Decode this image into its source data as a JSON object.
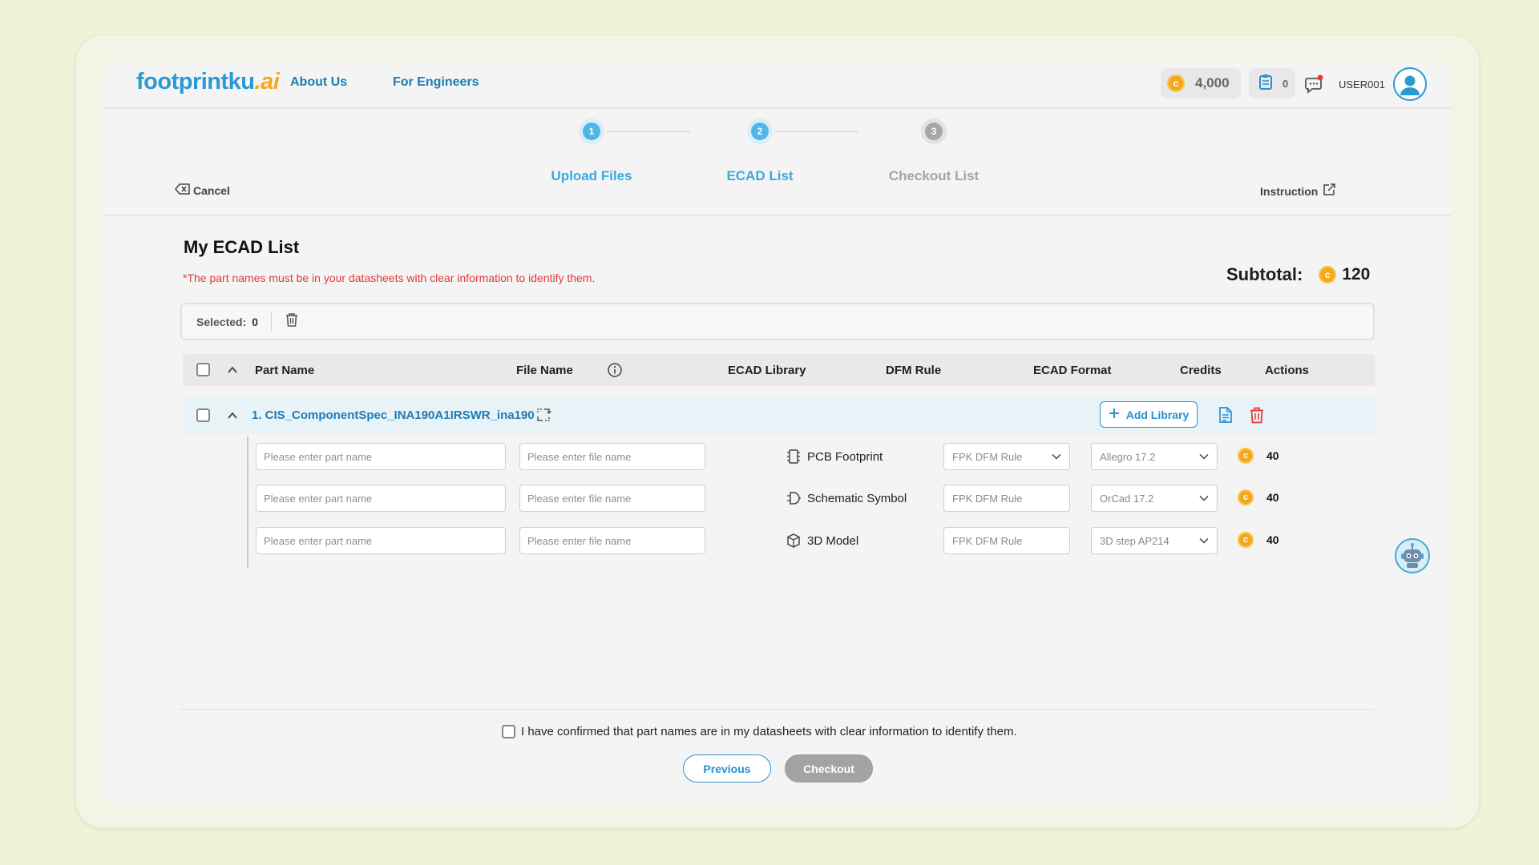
{
  "header": {
    "logo_main": "footprintku",
    "logo_suffix": ".ai",
    "nav": [
      "About Us",
      "For Engineers"
    ],
    "credits": "4,000",
    "cart_count": "0",
    "username": "USER001"
  },
  "stepper": {
    "cancel_label": "Cancel",
    "steps": [
      {
        "num": "1",
        "label": "Upload Files",
        "state": "active"
      },
      {
        "num": "2",
        "label": "ECAD List",
        "state": "active"
      },
      {
        "num": "3",
        "label": "Checkout List",
        "state": "inactive"
      }
    ],
    "instruction_label": "Instruction"
  },
  "list": {
    "title": "My ECAD List",
    "warning": "*The part names must be in your datasheets with clear information to identify them.",
    "subtotal_label": "Subtotal:",
    "subtotal_value": "120",
    "selected_label": "Selected:",
    "selected_count": "0"
  },
  "table": {
    "headers": {
      "part_name": "Part Name",
      "file_name": "File Name",
      "ecad_library": "ECAD Library",
      "dfm_rule": "DFM Rule",
      "ecad_format": "ECAD Format",
      "credits": "Credits",
      "actions": "Actions"
    },
    "group": {
      "name": "1. CIS_ComponentSpec_INA190A1IRSWR_ina190",
      "add_library_label": "Add Library"
    },
    "rows": [
      {
        "part_placeholder": "Please enter part name",
        "file_placeholder": "Please enter file name",
        "library": "PCB Footprint",
        "dfm_rule": "FPK DFM Rule",
        "format": "Allegro 17.2",
        "credits": "40"
      },
      {
        "part_placeholder": "Please enter part name",
        "file_placeholder": "Please enter file name",
        "library": "Schematic Symbol",
        "dfm_rule": "FPK DFM Rule",
        "format": "OrCad 17.2",
        "credits": "40"
      },
      {
        "part_placeholder": "Please enter part name",
        "file_placeholder": "Please enter file name",
        "library": "3D Model",
        "dfm_rule": "FPK DFM Rule",
        "format": "3D step AP214",
        "credits": "40"
      }
    ]
  },
  "footer": {
    "confirm_text": "I have confirmed that part names are in my datasheets with clear information to identify them.",
    "previous_label": "Previous",
    "checkout_label": "Checkout"
  },
  "colors": {
    "accent": "#2b9ad3",
    "coin": "#f6a81d",
    "warning": "#e03a3a",
    "delete": "#e53935"
  },
  "icons": [
    "coin-icon",
    "cart-icon",
    "chat-icon",
    "avatar-icon",
    "cancel-icon",
    "external-link-icon",
    "trash-icon",
    "info-icon",
    "chevron-up-icon",
    "swap-icon",
    "plus-icon",
    "document-icon",
    "chip-icon",
    "schematic-icon",
    "cube-icon",
    "chevron-down-icon",
    "robot-icon"
  ]
}
